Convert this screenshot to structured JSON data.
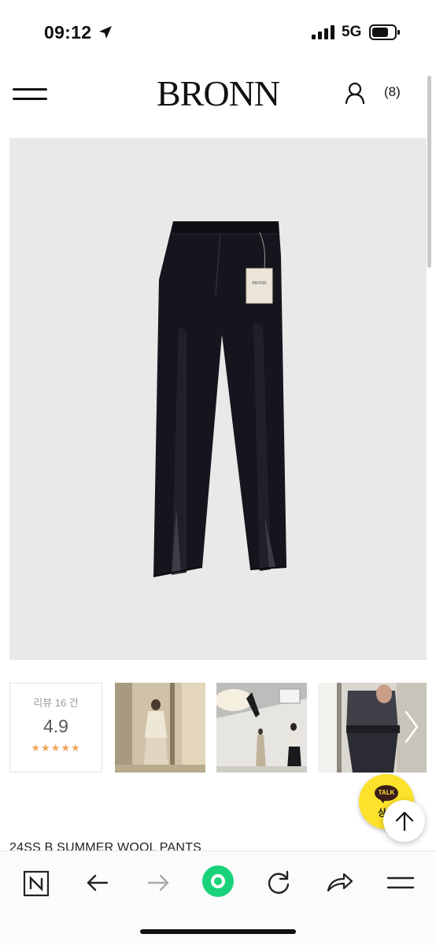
{
  "status_bar": {
    "time": "09:12",
    "network": "5G"
  },
  "header": {
    "logo": "BRONN",
    "cart_count": "(8)"
  },
  "reviews": {
    "label": "리뷰 16 건",
    "score": "4.9",
    "stars": "★★★★★"
  },
  "kakao": {
    "bubble": "TALK",
    "label": "상담"
  },
  "product": {
    "name": "24SS B SUMMER WOOL PANTS",
    "tag": "BRONN"
  },
  "colors": {
    "accent_green": "#19d27a",
    "kakao_yellow": "#fce22a",
    "star_orange": "#f0a55a"
  }
}
